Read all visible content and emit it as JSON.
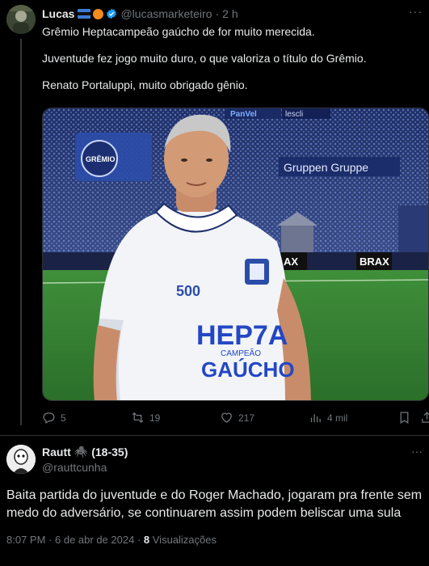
{
  "post1": {
    "author_name": "Lucas",
    "author_handle": "@lucasmarketeiro",
    "separator": "·",
    "time": "2 h",
    "more": "···",
    "lines": [
      "Grêmio Heptacampeão gaúcho de for muito merecida.",
      "Juventude fez jogo muito duro, o que valoriza o título do Grêmio.",
      "Renato Portaluppi, muito obrigado gênio."
    ],
    "media": {
      "banner_club": "GRÊMIO",
      "sponsor_top_left": "PanVel",
      "sponsor_top_right": "lescli",
      "banner_right": "Gruppen Gruppe",
      "board_left": "AX",
      "board_right": "BRAX",
      "shirt_number": "500",
      "shirt_line1": "HEP7A",
      "shirt_line2": "CAMPEÃO",
      "shirt_line3": "GAÚCHO"
    },
    "stats": {
      "replies": "5",
      "reposts": "19",
      "likes": "217",
      "views": "4 mil"
    }
  },
  "post2": {
    "author_name": "Rautt",
    "author_tag": "(18-35)",
    "spider_emoji": "🕷️",
    "author_handle": "@rauttcunha",
    "more": "···",
    "text": "Baita partida do juventude e do Roger Machado, jogaram pra frente sem medo do adversário, se continuarem assim podem beliscar uma sula",
    "time": "8:07 PM",
    "date": "6 de abr de 2024",
    "views_count": "8",
    "views_label": "Visualizações"
  },
  "colors": {
    "background": "#000000",
    "text": "#e7e9ea",
    "muted": "#71767b",
    "verified": "#1d9bf0"
  }
}
